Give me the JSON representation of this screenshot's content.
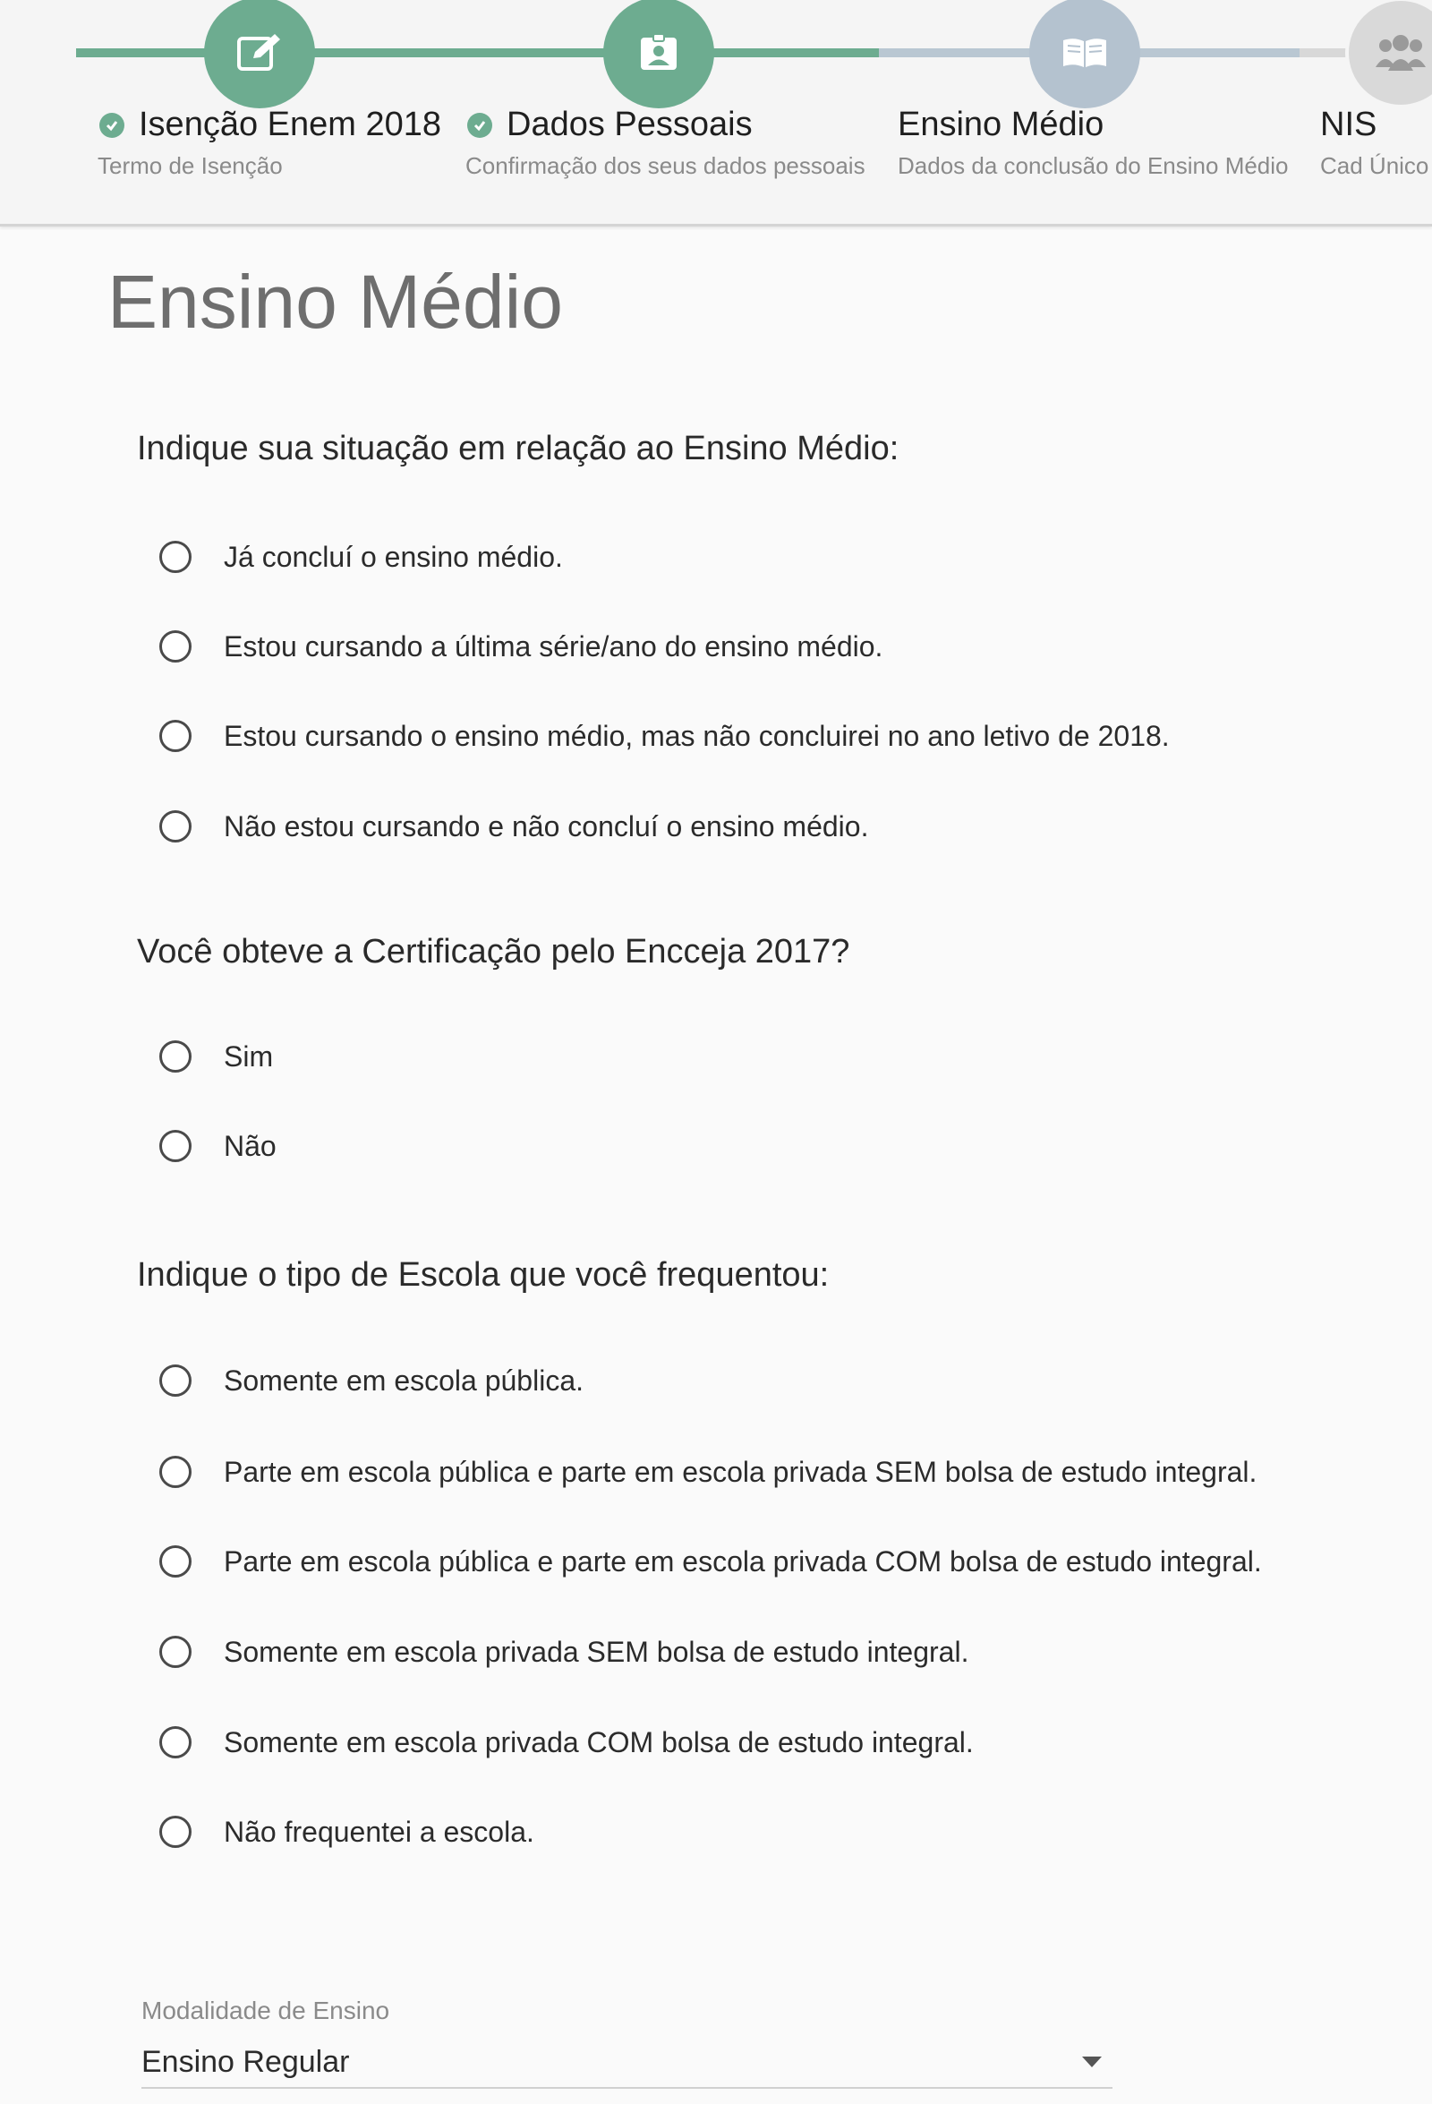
{
  "stepper": {
    "steps": [
      {
        "title": "Isenção Enem 2018",
        "subtitle": "Termo de Isenção",
        "status": "done",
        "icon": "edit-icon"
      },
      {
        "title": "Dados Pessoais",
        "subtitle": "Confirmação dos seus dados pessoais",
        "status": "done",
        "icon": "id-badge-icon"
      },
      {
        "title": "Ensino Médio",
        "subtitle": "Dados da conclusão do Ensino Médio",
        "status": "current",
        "icon": "book-icon"
      },
      {
        "title": "NIS",
        "subtitle": "Cad Único",
        "status": "pending",
        "icon": "users-icon"
      }
    ],
    "colors": {
      "done": "#6dac90",
      "current": "#b4c2cf",
      "pending": "#d9d9d9"
    }
  },
  "page": {
    "title": "Ensino Médio"
  },
  "questions": [
    {
      "text": "Indique sua situação em relação ao Ensino Médio:",
      "options": [
        "Já concluí o ensino médio.",
        "Estou cursando a última série/ano do ensino médio.",
        "Estou cursando o ensino médio, mas não concluirei no ano letivo de 2018.",
        "Não estou cursando e não concluí o ensino médio."
      ]
    },
    {
      "text": "Você obteve a Certificação pelo Encceja 2017?",
      "options": [
        "Sim",
        "Não"
      ]
    },
    {
      "text": "Indique o tipo de Escola que você frequentou:",
      "options": [
        "Somente em escola pública.",
        "Parte em escola pública e parte em escola privada SEM bolsa de estudo integral.",
        "Parte em escola pública e parte em escola privada COM bolsa de estudo integral.",
        "Somente em escola privada SEM bolsa de estudo integral.",
        "Somente em escola privada COM bolsa de estudo integral.",
        "Não frequentei a escola."
      ]
    }
  ],
  "modalidade": {
    "label": "Modalidade de Ensino",
    "value": "Ensino Regular"
  }
}
